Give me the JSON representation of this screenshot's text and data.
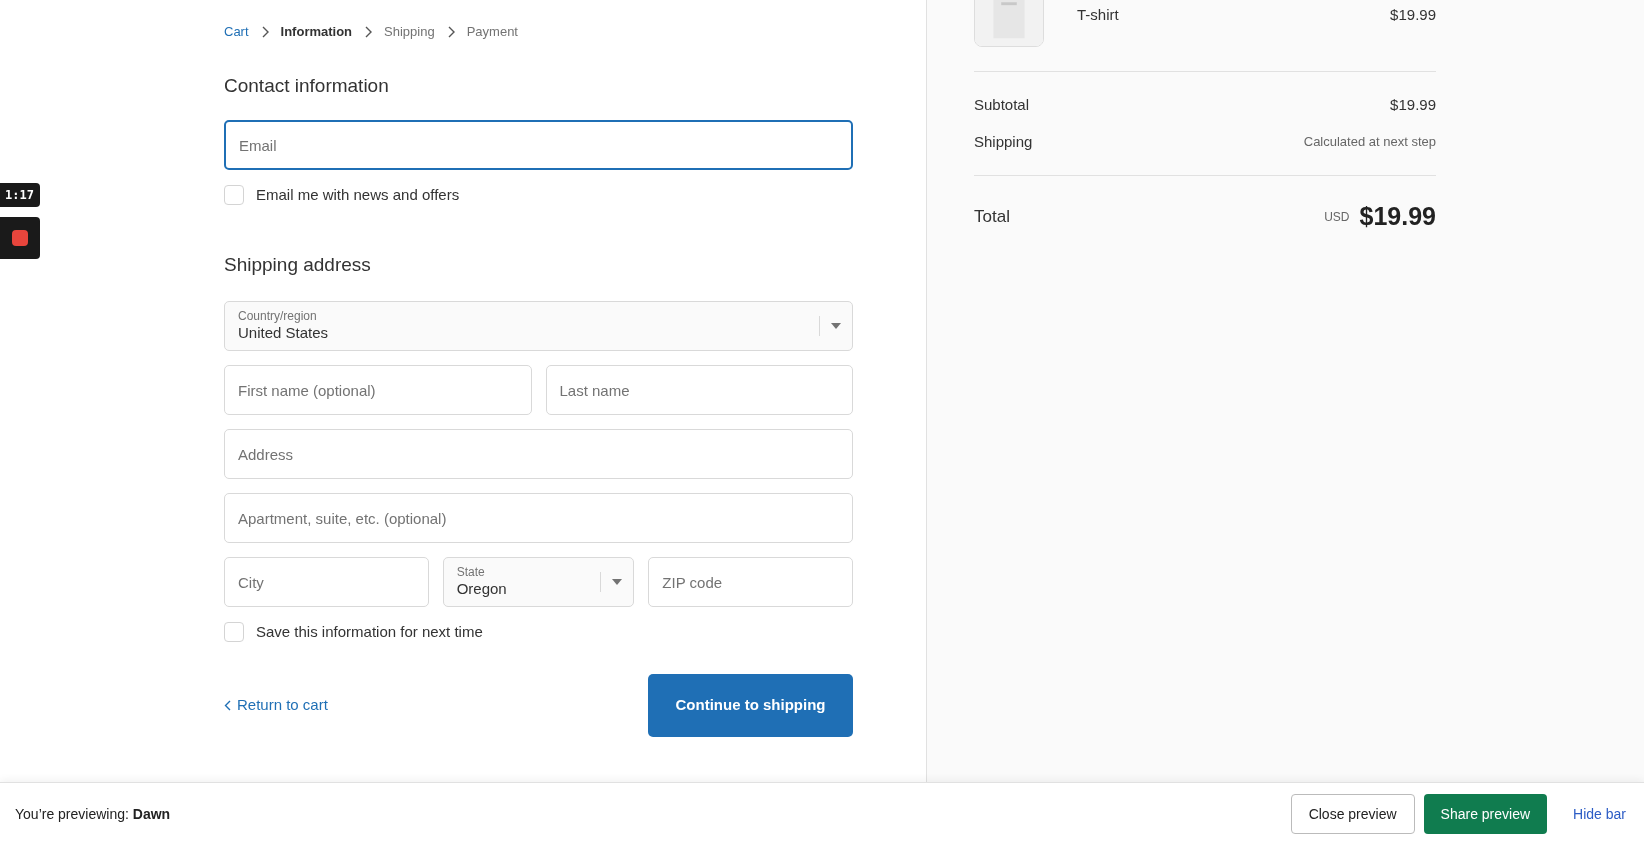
{
  "recorder": {
    "time": "1:17"
  },
  "breadcrumb": [
    {
      "label": "Cart",
      "kind": "link"
    },
    {
      "label": "Information",
      "kind": "current"
    },
    {
      "label": "Shipping",
      "kind": "upcoming"
    },
    {
      "label": "Payment",
      "kind": "upcoming"
    }
  ],
  "contact": {
    "heading": "Contact information",
    "email": {
      "placeholder": "Email",
      "focused": true
    },
    "newsletter": {
      "label": "Email me with news and offers",
      "checked": false
    }
  },
  "shipping": {
    "heading": "Shipping address",
    "rows": [
      [
        {
          "kind": "select",
          "label": "Country/region",
          "value": "United States"
        }
      ],
      [
        {
          "kind": "text",
          "placeholder": "First name (optional)"
        },
        {
          "kind": "text",
          "placeholder": "Last name"
        }
      ],
      [
        {
          "kind": "text",
          "placeholder": "Address"
        }
      ],
      [
        {
          "kind": "text",
          "placeholder": "Apartment, suite, etc. (optional)"
        }
      ],
      [
        {
          "kind": "text",
          "placeholder": "City"
        },
        {
          "kind": "select",
          "label": "State",
          "value": "Oregon"
        },
        {
          "kind": "text",
          "placeholder": "ZIP code"
        }
      ]
    ],
    "save": {
      "label": "Save this information for next time",
      "checked": false
    }
  },
  "return_link": "Return to cart",
  "continue_button": "Continue to shipping",
  "summary": {
    "items": [
      {
        "name": "T-shirt",
        "price": "$19.99"
      }
    ],
    "lines": [
      {
        "label": "Subtotal",
        "value": "$19.99",
        "kind": "amount"
      },
      {
        "label": "Shipping",
        "value": "Calculated at next step",
        "kind": "note"
      }
    ],
    "total": {
      "label": "Total",
      "currency": "USD",
      "amount": "$19.99"
    }
  },
  "preview_bar": {
    "prefix": "You’re previewing:",
    "theme": "Dawn",
    "close": "Close preview",
    "share": "Share preview",
    "hide": "Hide bar"
  }
}
